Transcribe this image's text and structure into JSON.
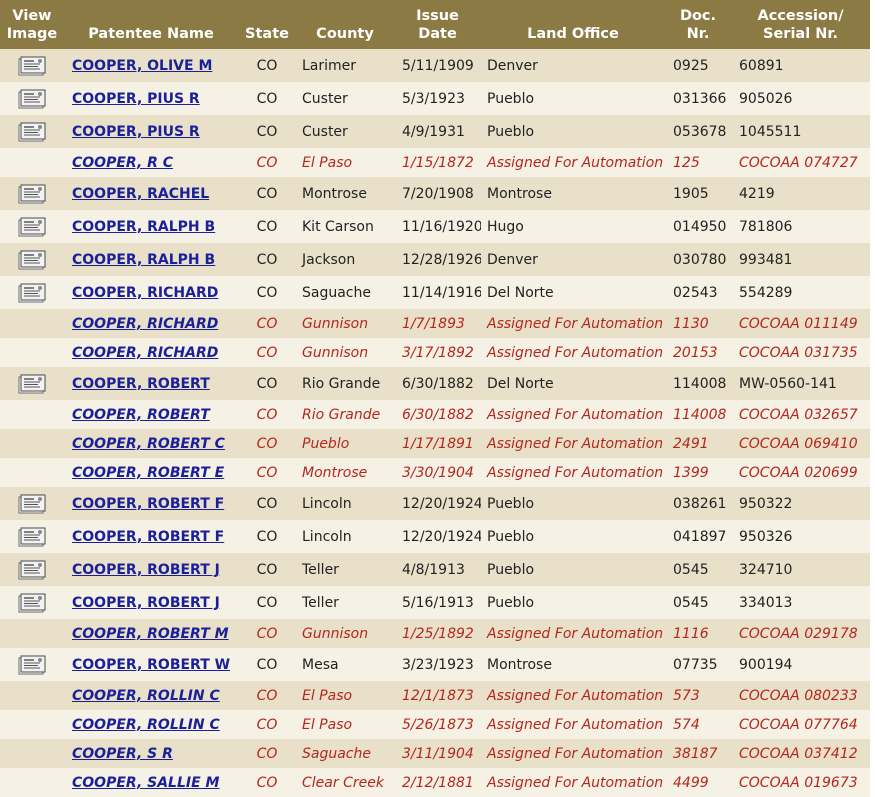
{
  "headers": {
    "view_image_1": "View",
    "view_image_2": "Image",
    "patentee_name": "Patentee Name",
    "state": "State",
    "county": "County",
    "issue_1": "Issue",
    "issue_2": "Date",
    "land_office": "Land Office",
    "doc_1": "Doc.",
    "doc_2": "Nr.",
    "acc_1": "Accession/",
    "acc_2": "Serial Nr."
  },
  "colors": {
    "header_bg": "#8b7a43",
    "row_odd": "#e8e0c8",
    "row_even": "#f5f1e4",
    "link": "#1a1f9a",
    "automation_text": "#b5261e"
  },
  "icons": {
    "view_image": "document-image-icon"
  },
  "rows": [
    {
      "image": true,
      "name": "COOPER, OLIVE M",
      "state": "CO",
      "county": "Larimer",
      "date": "5/11/1909",
      "office": "Denver",
      "doc": "0925",
      "acc": "60891"
    },
    {
      "image": true,
      "name": "COOPER, PIUS R",
      "state": "CO",
      "county": "Custer",
      "date": "5/3/1923",
      "office": "Pueblo",
      "doc": "031366",
      "acc": "905026"
    },
    {
      "image": true,
      "name": "COOPER, PIUS R",
      "state": "CO",
      "county": "Custer",
      "date": "4/9/1931",
      "office": "Pueblo",
      "doc": "053678",
      "acc": "1045511"
    },
    {
      "image": false,
      "name": "COOPER, R C",
      "state": "CO",
      "county": "El Paso",
      "date": "1/15/1872",
      "office": "Assigned For Automation",
      "doc": "125",
      "acc": "COCOAA 074727"
    },
    {
      "image": true,
      "name": "COOPER, RACHEL",
      "state": "CO",
      "county": "Montrose",
      "date": "7/20/1908",
      "office": "Montrose",
      "doc": "1905",
      "acc": "4219"
    },
    {
      "image": true,
      "name": "COOPER, RALPH B",
      "state": "CO",
      "county": "Kit Carson",
      "date": "11/16/1920",
      "office": "Hugo",
      "doc": "014950",
      "acc": "781806"
    },
    {
      "image": true,
      "name": "COOPER, RALPH B",
      "state": "CO",
      "county": "Jackson",
      "date": "12/28/1926",
      "office": "Denver",
      "doc": "030780",
      "acc": "993481"
    },
    {
      "image": true,
      "name": "COOPER, RICHARD",
      "state": "CO",
      "county": "Saguache",
      "date": "11/14/1916",
      "office": "Del Norte",
      "doc": "02543",
      "acc": "554289"
    },
    {
      "image": false,
      "name": "COOPER, RICHARD",
      "state": "CO",
      "county": "Gunnison",
      "date": "1/7/1893",
      "office": "Assigned For Automation",
      "doc": "1130",
      "acc": "COCOAA 011149"
    },
    {
      "image": false,
      "name": "COOPER, RICHARD",
      "state": "CO",
      "county": "Gunnison",
      "date": "3/17/1892",
      "office": "Assigned For Automation",
      "doc": "20153",
      "acc": "COCOAA 031735"
    },
    {
      "image": true,
      "name": "COOPER, ROBERT",
      "state": "CO",
      "county": "Rio Grande",
      "date": "6/30/1882",
      "office": "Del Norte",
      "doc": "114008",
      "acc": "MW-0560-141"
    },
    {
      "image": false,
      "name": "COOPER, ROBERT",
      "state": "CO",
      "county": "Rio Grande",
      "date": "6/30/1882",
      "office": "Assigned For Automation",
      "doc": "114008",
      "acc": "COCOAA 032657"
    },
    {
      "image": false,
      "name": "COOPER, ROBERT C",
      "state": "CO",
      "county": "Pueblo",
      "date": "1/17/1891",
      "office": "Assigned For Automation",
      "doc": "2491",
      "acc": "COCOAA 069410"
    },
    {
      "image": false,
      "name": "COOPER, ROBERT E",
      "state": "CO",
      "county": "Montrose",
      "date": "3/30/1904",
      "office": "Assigned For Automation",
      "doc": "1399",
      "acc": "COCOAA 020699"
    },
    {
      "image": true,
      "name": "COOPER, ROBERT F",
      "state": "CO",
      "county": "Lincoln",
      "date": "12/20/1924",
      "office": "Pueblo",
      "doc": "038261",
      "acc": "950322"
    },
    {
      "image": true,
      "name": "COOPER, ROBERT F",
      "state": "CO",
      "county": "Lincoln",
      "date": "12/20/1924",
      "office": "Pueblo",
      "doc": "041897",
      "acc": "950326"
    },
    {
      "image": true,
      "name": "COOPER, ROBERT J",
      "state": "CO",
      "county": "Teller",
      "date": "4/8/1913",
      "office": "Pueblo",
      "doc": "0545",
      "acc": "324710"
    },
    {
      "image": true,
      "name": "COOPER, ROBERT J",
      "state": "CO",
      "county": "Teller",
      "date": "5/16/1913",
      "office": "Pueblo",
      "doc": "0545",
      "acc": "334013"
    },
    {
      "image": false,
      "name": "COOPER, ROBERT M",
      "state": "CO",
      "county": "Gunnison",
      "date": "1/25/1892",
      "office": "Assigned For Automation",
      "doc": "1116",
      "acc": "COCOAA 029178"
    },
    {
      "image": true,
      "name": "COOPER, ROBERT W",
      "state": "CO",
      "county": "Mesa",
      "date": "3/23/1923",
      "office": "Montrose",
      "doc": "07735",
      "acc": "900194"
    },
    {
      "image": false,
      "name": "COOPER, ROLLIN C",
      "state": "CO",
      "county": "El Paso",
      "date": "12/1/1873",
      "office": "Assigned For Automation",
      "doc": "573",
      "acc": "COCOAA 080233"
    },
    {
      "image": false,
      "name": "COOPER, ROLLIN C",
      "state": "CO",
      "county": "El Paso",
      "date": "5/26/1873",
      "office": "Assigned For Automation",
      "doc": "574",
      "acc": "COCOAA 077764"
    },
    {
      "image": false,
      "name": "COOPER, S R",
      "state": "CO",
      "county": "Saguache",
      "date": "3/11/1904",
      "office": "Assigned For Automation",
      "doc": "38187",
      "acc": "COCOAA 037412"
    },
    {
      "image": false,
      "name": "COOPER, SALLIE M",
      "state": "CO",
      "county": "Clear Creek",
      "date": "2/12/1881",
      "office": "Assigned For Automation",
      "doc": "4499",
      "acc": "COCOAA 019673"
    }
  ]
}
